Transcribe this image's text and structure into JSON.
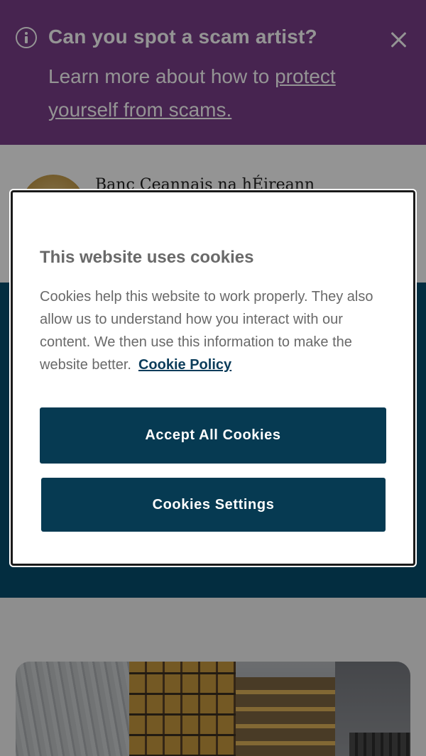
{
  "alert": {
    "title": "Can you spot a scam artist?",
    "body_prefix": "Learn more about how to ",
    "body_link": "protect yourself from scams.",
    "icon": "info-icon",
    "close_icon": "close-icon"
  },
  "header": {
    "logo_text": "Banc Ceannais na hÉireann"
  },
  "cookie_banner": {
    "title": "This website uses cookies",
    "text": "Cookies help this website to work properly. They also allow us to understand how you interact with our content. We then use this information to make the website better.",
    "policy_link": "Cookie Policy",
    "accept_label": "Accept All Cookies",
    "settings_label": "Cookies Settings"
  },
  "colors": {
    "alert_bg": "#7b3f8a",
    "hero_bg": "#064f6e",
    "button_bg": "#063a52",
    "link": "#0b3c5a"
  }
}
